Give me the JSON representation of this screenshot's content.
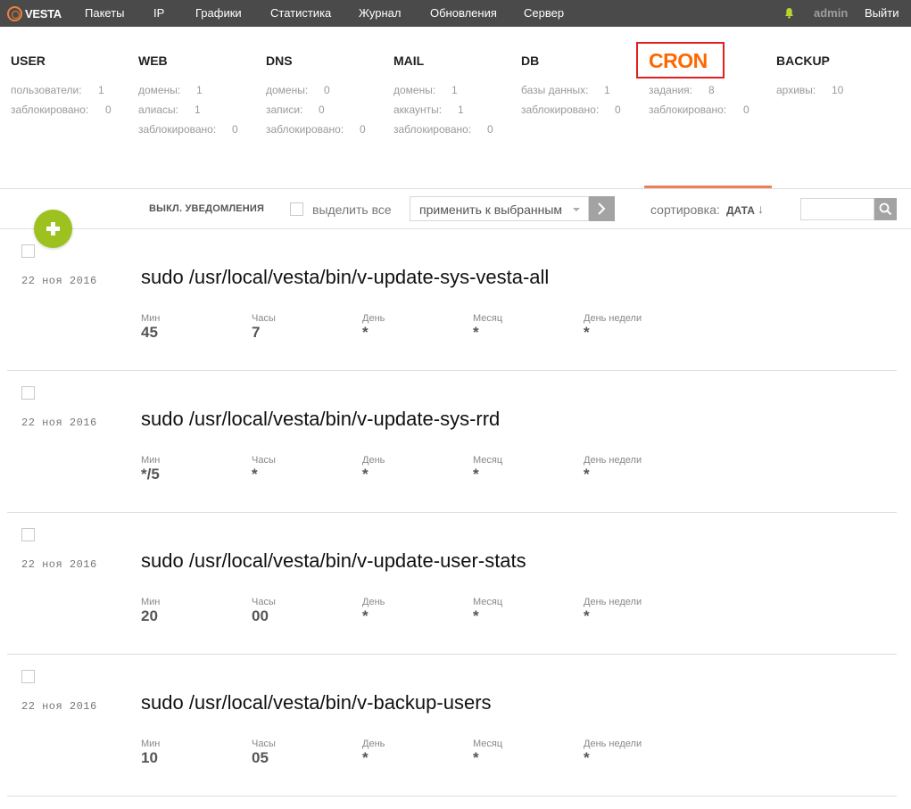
{
  "header": {
    "logo_text": "VESTA",
    "nav": [
      "Пакеты",
      "IP",
      "Графики",
      "Статистика",
      "Журнал",
      "Обновления",
      "Сервер"
    ],
    "user": "admin",
    "logout": "Выйти"
  },
  "panels": {
    "user": {
      "title": "USER",
      "stats": [
        {
          "k": "пользователи:",
          "v": "1"
        },
        {
          "k": "заблокировано:",
          "v": "0"
        }
      ]
    },
    "web": {
      "title": "WEB",
      "stats": [
        {
          "k": "домены:",
          "v": "1"
        },
        {
          "k": "алиасы:",
          "v": "1"
        },
        {
          "k": "заблокировано:",
          "v": "0"
        }
      ]
    },
    "dns": {
      "title": "DNS",
      "stats": [
        {
          "k": "домены:",
          "v": "0"
        },
        {
          "k": "записи:",
          "v": "0"
        },
        {
          "k": "заблокировано:",
          "v": "0"
        }
      ]
    },
    "mail": {
      "title": "MAIL",
      "stats": [
        {
          "k": "домены:",
          "v": "1"
        },
        {
          "k": "аккаунты:",
          "v": "1"
        },
        {
          "k": "заблокировано:",
          "v": "0"
        }
      ]
    },
    "db": {
      "title": "DB",
      "stats": [
        {
          "k": "базы данных:",
          "v": "1"
        },
        {
          "k": "заблокировано:",
          "v": "0"
        }
      ]
    },
    "cron": {
      "title": "CRON",
      "stats": [
        {
          "k": "задания:",
          "v": "8"
        },
        {
          "k": "заблокировано:",
          "v": "0"
        }
      ]
    },
    "backup": {
      "title": "BACKUP",
      "stats": [
        {
          "k": "архивы:",
          "v": "10"
        }
      ]
    }
  },
  "toolbar": {
    "mute_label": "ВЫКЛ. УВЕДОМЛЕНИЯ",
    "select_all_label": "выделить все",
    "apply_placeholder": "применить к выбранным",
    "sort_label": "сортировка:",
    "sort_value": "ДАТА",
    "sort_arrow": "↓"
  },
  "field_labels": {
    "min": "Мин",
    "hour": "Часы",
    "day": "День",
    "month": "Месяц",
    "wday": "День недели"
  },
  "jobs": [
    {
      "date": "22 ноя 2016",
      "command": "sudo /usr/local/vesta/bin/v-update-sys-vesta-all",
      "min": "45",
      "hour": "7",
      "day": "*",
      "month": "*",
      "wday": "*"
    },
    {
      "date": "22 ноя 2016",
      "command": "sudo /usr/local/vesta/bin/v-update-sys-rrd",
      "min": "*/5",
      "hour": "*",
      "day": "*",
      "month": "*",
      "wday": "*"
    },
    {
      "date": "22 ноя 2016",
      "command": "sudo /usr/local/vesta/bin/v-update-user-stats",
      "min": "20",
      "hour": "00",
      "day": "*",
      "month": "*",
      "wday": "*"
    },
    {
      "date": "22 ноя 2016",
      "command": "sudo /usr/local/vesta/bin/v-backup-users",
      "min": "10",
      "hour": "05",
      "day": "*",
      "month": "*",
      "wday": "*"
    }
  ],
  "colors": {
    "topbar": "#4a4a4a",
    "accent": "#ff6701",
    "add_button": "#9dc11e",
    "highlight_box": "#e0201e"
  }
}
